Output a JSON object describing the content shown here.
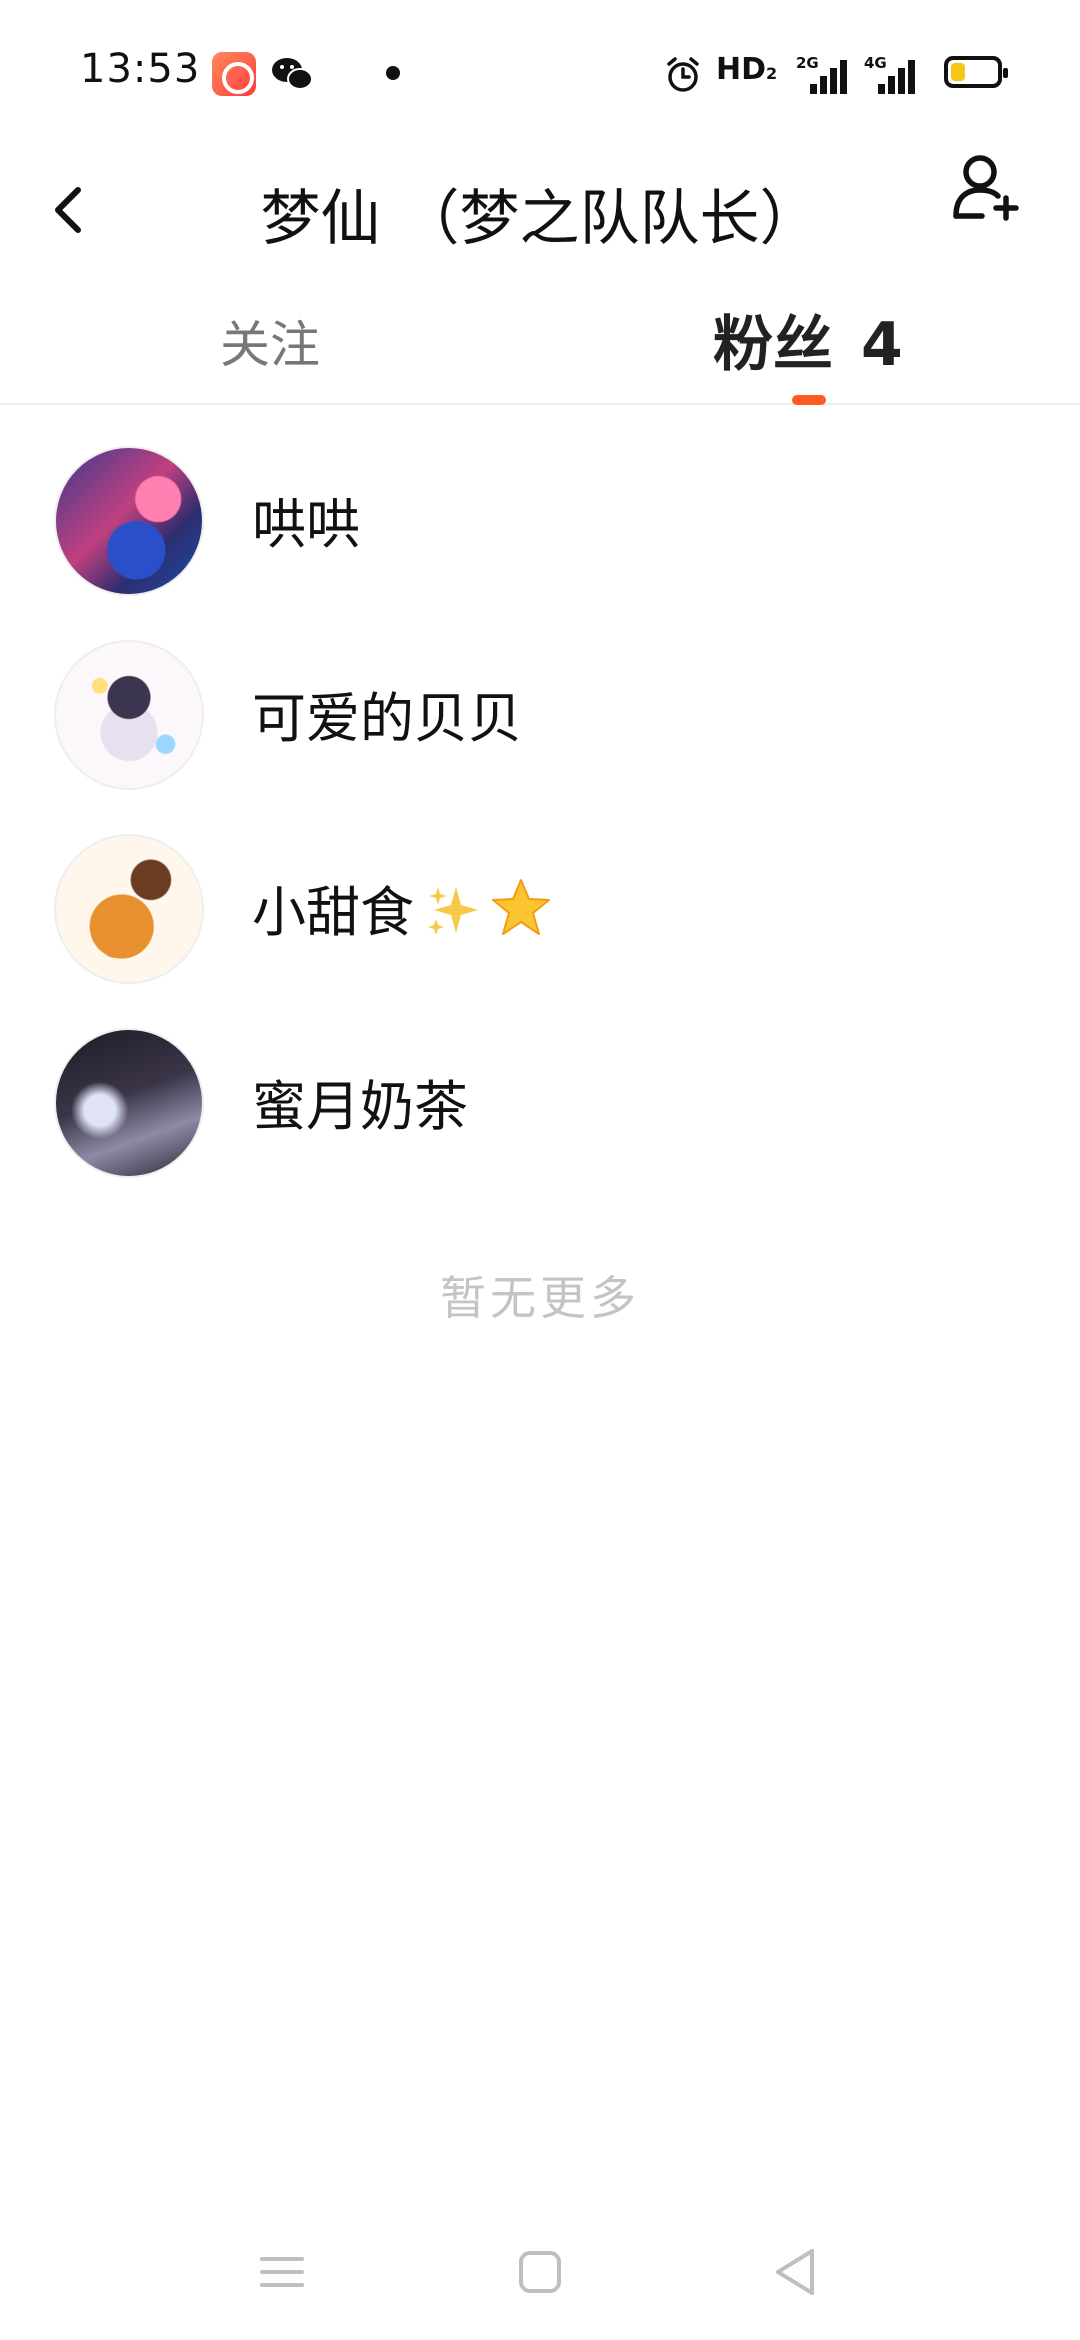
{
  "status_bar": {
    "time": "13:53",
    "hd_label": "HD",
    "hd_sub": "2",
    "sig1_label": "2G",
    "sig2_label": "4G",
    "icons": [
      "kuaishou-app-icon",
      "wechat-icon",
      "notification-dot",
      "alarm-icon",
      "signal-icon",
      "battery-icon"
    ],
    "battery_level": 0.25
  },
  "header": {
    "title": "梦仙 （梦之队队长）",
    "back_icon": "chevron-left-icon",
    "add_icon": "add-user-icon"
  },
  "tabs": {
    "follow_label": "关注",
    "fans_label": "粉丝",
    "fans_count": "4",
    "active": "fans",
    "accent": "#ff5a1f"
  },
  "fans": [
    {
      "name": "哄哄"
    },
    {
      "name": "可爱的贝贝"
    },
    {
      "name": "小甜食"
    },
    {
      "name": "蜜月奶茶"
    }
  ],
  "no_more": "暂无更多",
  "nav_bar": {
    "icons": [
      "menu-icon",
      "home-icon",
      "back-triangle-icon"
    ]
  }
}
